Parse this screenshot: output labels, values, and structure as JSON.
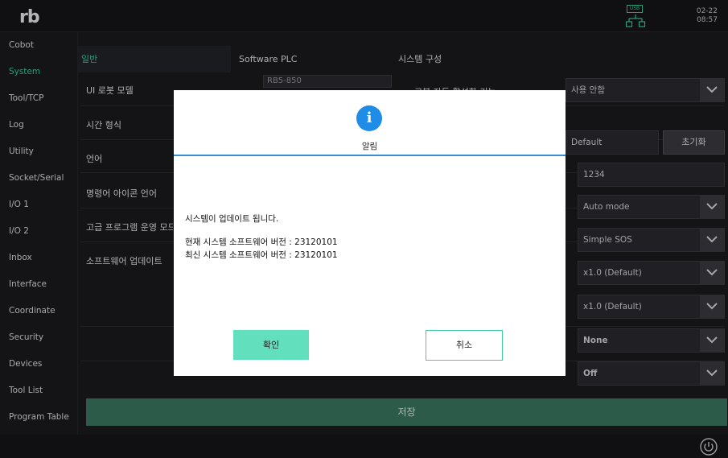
{
  "app": {
    "logo": "rb",
    "usb_label": "USB",
    "date": "02-22",
    "time": "08:57"
  },
  "sidebar": {
    "items": [
      {
        "label": "Cobot"
      },
      {
        "label": "System"
      },
      {
        "label": "Tool/TCP"
      },
      {
        "label": "Log"
      },
      {
        "label": "Utility"
      },
      {
        "label": "Socket/Serial"
      },
      {
        "label": "I/O 1"
      },
      {
        "label": "I/O 2"
      },
      {
        "label": "Inbox"
      },
      {
        "label": "Interface"
      },
      {
        "label": "Coordinate"
      },
      {
        "label": "Security"
      },
      {
        "label": "Devices"
      },
      {
        "label": "Tool List"
      },
      {
        "label": "Program Table"
      }
    ],
    "active": "System",
    "accent": "#3ecf9c"
  },
  "tabs": [
    {
      "label": "일반"
    },
    {
      "label": "Software PLC"
    },
    {
      "label": "시스템 구성"
    }
  ],
  "settings": {
    "labels": [
      "UI 로봇 모델",
      "시간 형식",
      "언어",
      "명령어 아이콘 언어",
      "고급 프로그램 운영 모드",
      "소프트웨어 업데이트"
    ],
    "robot_model_value": "RB5-850",
    "right_label": "로봇 자동 활성화 기능",
    "auto_enable_value": "사용 안함",
    "default_value": "Default",
    "reset_button": "초기화",
    "password_value": "1234",
    "mode_value": "Auto mode",
    "sos_value": "Simple SOS",
    "speed1_value": "x1.0 (Default)",
    "speed2_value": "x1.0 (Default)",
    "none_value": "None",
    "off_value": "Off"
  },
  "save_button": "저장",
  "dialog": {
    "icon": "info-icon",
    "icon_glyph": "i",
    "title": "알림",
    "message": "시스템이 업데이트 됩니다.",
    "current_version": "현재 시스템 소프트웨어 버전 : 23120101",
    "latest_version": "최신 시스템 소프트웨어 버전 : 23120101",
    "ok_label": "확인",
    "cancel_label": "취소",
    "ok_color": "#62e0bd",
    "info_color": "#1f8de8"
  }
}
